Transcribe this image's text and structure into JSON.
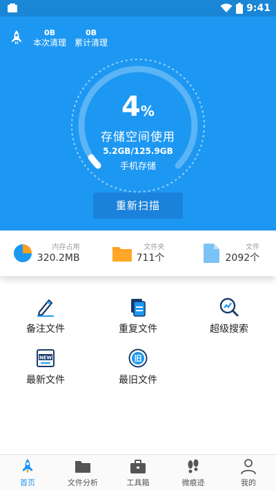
{
  "status": {
    "time": "9:41"
  },
  "header": {
    "stats": [
      {
        "value": "0B",
        "label": "本次清理"
      },
      {
        "value": "0B",
        "label": "累计清理"
      }
    ]
  },
  "gauge": {
    "percent_value": "4",
    "percent_sign": "%",
    "caption": "存储空间使用",
    "size": "5.2GB/125.9GB",
    "sub": "手机存储",
    "fraction": 0.04
  },
  "rescan_label": "重新扫描",
  "summary": [
    {
      "label": "内存占用",
      "value": "320.2MB",
      "icon": "pie-chart-icon"
    },
    {
      "label": "文件夹",
      "value": "711个",
      "icon": "folder-icon"
    },
    {
      "label": "文件",
      "value": "2092个",
      "icon": "file-icon"
    }
  ],
  "tools": [
    {
      "label": "备注文件",
      "icon": "pencil-icon"
    },
    {
      "label": "重复文件",
      "icon": "duplicate-file-icon"
    },
    {
      "label": "超级搜索",
      "icon": "search-chart-icon"
    },
    {
      "label": "最新文件",
      "icon": "new-badge-icon"
    },
    {
      "label": "最旧文件",
      "icon": "old-clock-icon"
    }
  ],
  "tabs": [
    {
      "label": "首页",
      "icon": "rocket-icon",
      "active": true
    },
    {
      "label": "文件分析",
      "icon": "folder-icon"
    },
    {
      "label": "工具箱",
      "icon": "toolbox-icon"
    },
    {
      "label": "微痕迹",
      "icon": "footprints-icon"
    },
    {
      "label": "我的",
      "icon": "person-icon"
    }
  ],
  "colors": {
    "primary": "#1d98f2",
    "status_bar": "#1a86d6",
    "button": "#1a82da",
    "orange": "#ff9f1c",
    "light_blue": "#7cc3f5",
    "navy": "#1a3a6b"
  }
}
